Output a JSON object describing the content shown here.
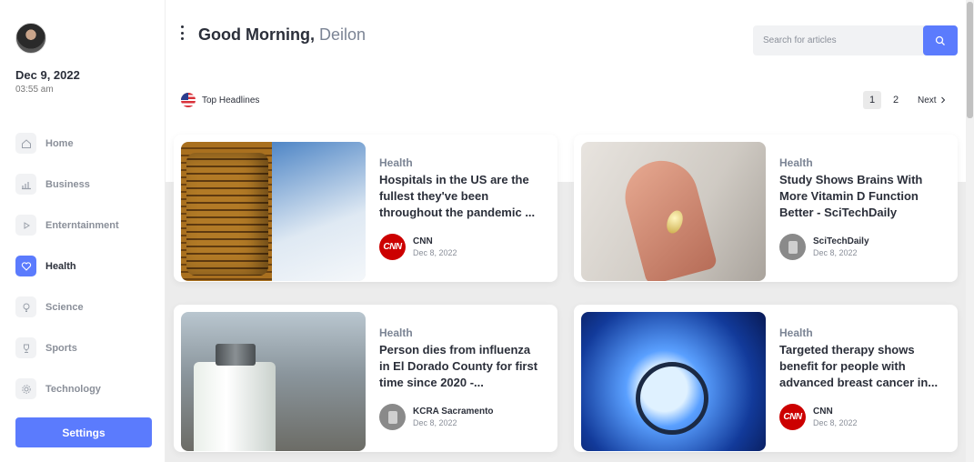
{
  "sidebar": {
    "date": "Dec 9, 2022",
    "time": "03:55 am",
    "items": [
      {
        "label": "Home",
        "icon": "home-icon"
      },
      {
        "label": "Business",
        "icon": "bar-chart-icon"
      },
      {
        "label": "Enterntainment",
        "icon": "play-icon"
      },
      {
        "label": "Health",
        "icon": "heart-icon",
        "active": true
      },
      {
        "label": "Science",
        "icon": "lightbulb-icon"
      },
      {
        "label": "Sports",
        "icon": "trophy-icon"
      },
      {
        "label": "Technology",
        "icon": "gear-icon"
      }
    ],
    "settings_label": "Settings"
  },
  "header": {
    "greeting": "Good Morning,",
    "name": "Deilon",
    "search_placeholder": "Search for articles"
  },
  "section": {
    "label": "Top Headlines",
    "flag": "us-flag-icon"
  },
  "pagination": {
    "pages": [
      "1",
      "2"
    ],
    "current": "1",
    "next_label": "Next"
  },
  "articles": [
    {
      "category": "Health",
      "title": "Hospitals in the US are the fullest they've been throughout the pandemic ...",
      "source": "CNN",
      "date": "Dec 8, 2022",
      "logo_text": "CNN"
    },
    {
      "category": "Health",
      "title": "Study Shows Brains With More Vitamin D Function Better - SciTechDaily",
      "source": "SciTechDaily",
      "date": "Dec 8, 2022",
      "logo_text": ""
    },
    {
      "category": "Health",
      "title": "Person dies from influenza in El Dorado County for first time since 2020 -...",
      "source": "KCRA Sacramento",
      "date": "Dec 8, 2022",
      "logo_text": ""
    },
    {
      "category": "Health",
      "title": "Targeted therapy shows benefit for people with advanced breast cancer in...",
      "source": "CNN",
      "date": "Dec 8, 2022",
      "logo_text": "CNN"
    }
  ],
  "colors": {
    "accent": "#5b7bfd",
    "cnn_red": "#cc0000",
    "muted_text": "#8a8f99"
  }
}
